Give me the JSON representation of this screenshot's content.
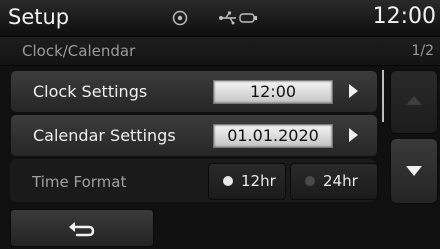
{
  "status_bar": {
    "title": "Setup",
    "time": "12:00",
    "icons": [
      "disc-icon",
      "usb-icon"
    ]
  },
  "subheader": {
    "section": "Clock/Calendar",
    "page": "1/2"
  },
  "rows": [
    {
      "label": "Clock Settings",
      "value": "12:00",
      "arrow": "right-arrow-icon"
    },
    {
      "label": "Calendar Settings",
      "value": "01.01.2020",
      "arrow": "right-arrow-icon"
    }
  ],
  "time_format": {
    "label": "Time Format",
    "options": [
      {
        "label": "12hr",
        "selected": true
      },
      {
        "label": "24hr",
        "selected": false
      }
    ]
  },
  "scroll": {
    "up_icon": "up-arrow-icon",
    "down_icon": "down-arrow-icon"
  },
  "back": {
    "icon": "back-arrow-icon"
  }
}
